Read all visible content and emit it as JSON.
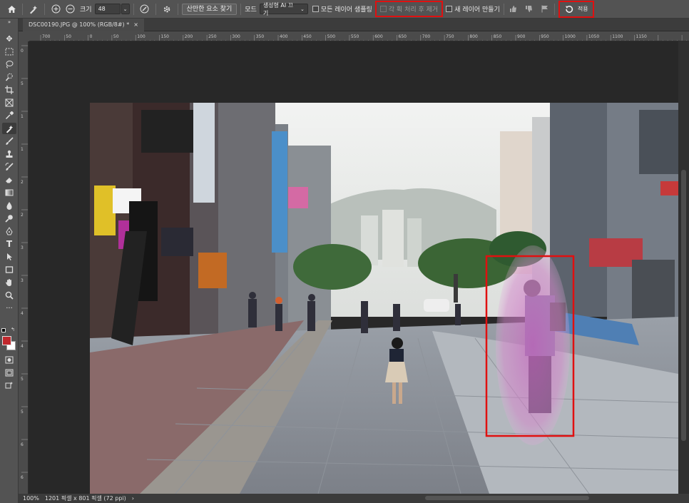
{
  "options_bar": {
    "size_label": "크기",
    "size_value": "48",
    "find_distractions_label": "산만한 요소 찾기",
    "mode_label": "모드",
    "mode_value": "생성형 AI 끄기",
    "sample_all_layers_label": "모든 레이어 샘플링",
    "remove_after_each_stroke_label": "각 획 처리 후 제거",
    "new_layer_label": "새 레이어 만들기",
    "apply_label": "적용"
  },
  "document": {
    "tab_title": "DSC00190.JPG @ 100% (RGB/8#) *",
    "tab_close": "×"
  },
  "status": {
    "zoom": "100%",
    "info": "1201 픽셀 x 801 픽셀 (72 ppi)",
    "arrow": "›"
  },
  "rulers": {
    "h": [
      "700",
      "50",
      "0",
      "50",
      "100",
      "150",
      "200",
      "250",
      "300",
      "350",
      "400",
      "450",
      "500",
      "550",
      "600",
      "650",
      "700",
      "750",
      "800",
      "850",
      "900",
      "950",
      "1000",
      "1050",
      "1100",
      "1150"
    ],
    "v": [
      "0",
      "5",
      "1",
      "1",
      "2",
      "2",
      "3",
      "3",
      "4",
      "4",
      "5",
      "5",
      "6",
      "6"
    ]
  },
  "icons": {
    "home": "home-icon",
    "brush": "remove-tool-icon",
    "add": "plus-circle-icon",
    "subtract": "minus-circle-icon",
    "pressure": "pressure-icon",
    "settings": "gear-icon",
    "thumbs_up": "thumbs-up-icon",
    "thumbs_down": "thumbs-down-icon",
    "flag": "flag-icon",
    "undo": "undo-arrow-icon"
  },
  "colors": {
    "foreground": "#c0282d",
    "background": "#ffffff",
    "highlight": "#e01010"
  }
}
